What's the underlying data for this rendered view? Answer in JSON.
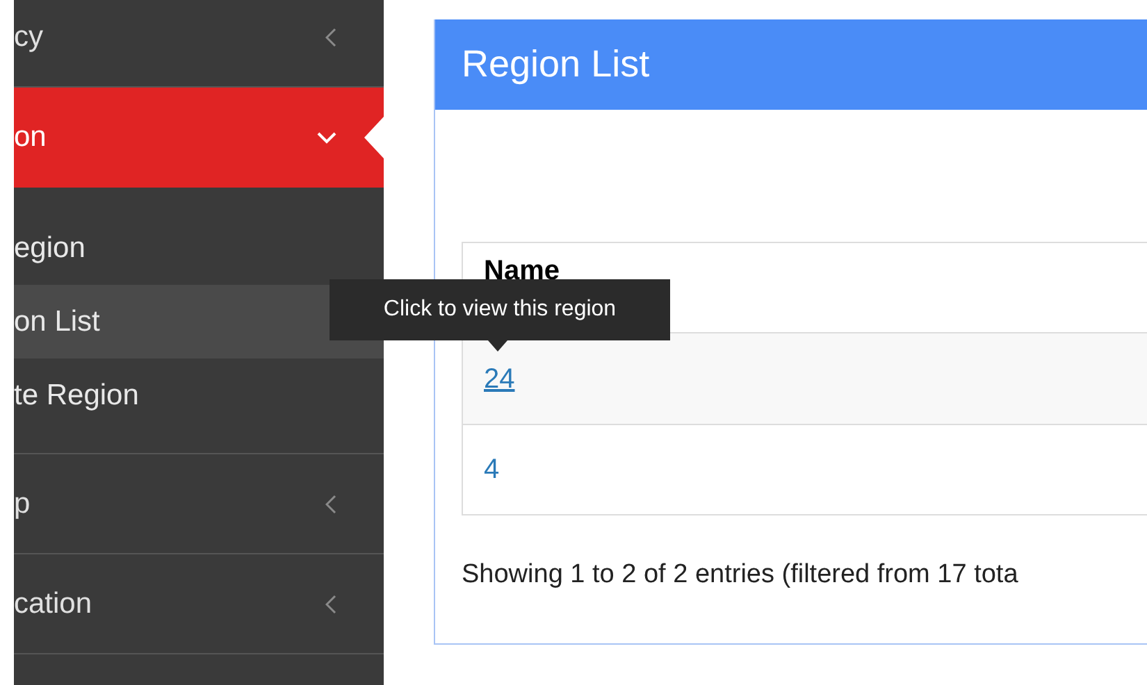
{
  "sidebar": {
    "items": [
      {
        "label": "cy",
        "expanded": false,
        "active": false
      },
      {
        "label": "on",
        "expanded": true,
        "active": true,
        "children": [
          {
            "label": "egion",
            "selected": false
          },
          {
            "label": "on List",
            "selected": true
          },
          {
            "label": "te Region",
            "selected": false
          }
        ]
      },
      {
        "label": "p",
        "expanded": false,
        "active": false
      },
      {
        "label": "cation",
        "expanded": false,
        "active": false
      }
    ]
  },
  "panel": {
    "title": "Region List",
    "table": {
      "columns": [
        "Name"
      ],
      "rows": [
        {
          "cells": [
            "24"
          ],
          "hovered": true
        },
        {
          "cells": [
            "4"
          ],
          "hovered": false
        }
      ]
    },
    "info": "Showing 1 to 2 of 2 entries (filtered from 17 tota"
  },
  "tooltip": {
    "text": "Click to view this region"
  }
}
